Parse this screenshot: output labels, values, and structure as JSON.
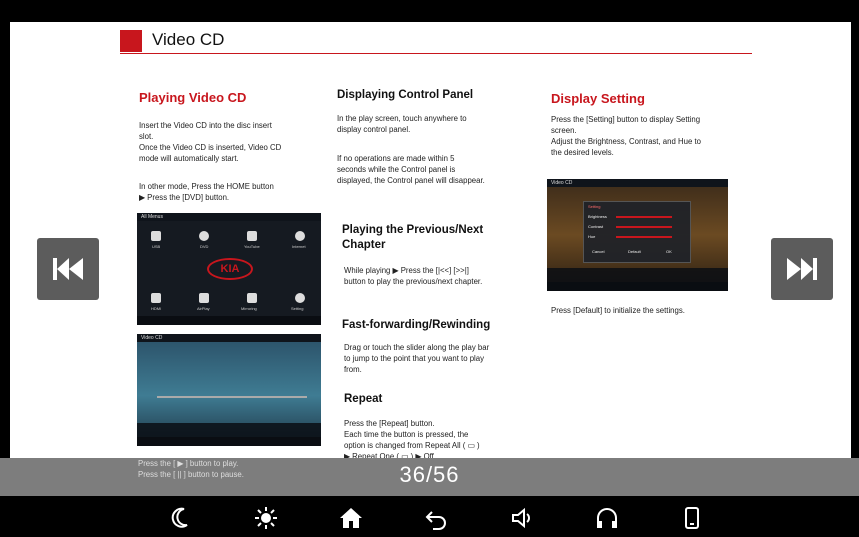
{
  "header": {
    "title": "Video CD"
  },
  "col1": {
    "heading": "Playing Video CD",
    "para1": "Insert the Video CD into the disc insert\nslot.\nOnce the Video CD is inserted, Video CD\nmode will automatically start.",
    "para2": "In other mode, Press the HOME button\n▶ Press the [DVD] button.",
    "menu_screen": {
      "title": "All Menus",
      "items": [
        "USB",
        "DVD",
        "YouTube",
        "Internet",
        "HDMI",
        "AirPlay",
        "Mirroring",
        "Setting"
      ],
      "logo": "KIA"
    },
    "video_screen": {
      "title": "Video CD"
    },
    "caption": "Press the [ ▶ ] button to play.\nPress the [ || ] button to pause."
  },
  "col2": {
    "h1": "Displaying Control Panel",
    "p1": "In the play screen, touch anywhere to\ndisplay control panel.",
    "p2": "If no operations are made within 5\nseconds while the Control panel is\ndisplayed, the Control panel will disappear.",
    "h2": "Playing the Previous/Next\nChapter",
    "p3": "While playing ▶ Press the [|<<] [>>|]\nbutton to play the previous/next chapter.",
    "h3": "Fast-forwarding/Rewinding",
    "p4": "Drag or touch the slider along the play bar\nto jump to the point that you want to play\nfrom.",
    "h4": "Repeat",
    "p5": "Press the [Repeat] button.\nEach time the button is pressed, the\noption is changed from Repeat All ( ▭ )\n▶ Repeat One ( ▭ ) ▶ Off."
  },
  "col3": {
    "heading": "Display Setting",
    "p1": "Press the [Setting] button to display Setting\nscreen.\nAdjust the Brightness, Contrast, and Hue to\nthe desired levels.",
    "settings_screen": {
      "title": "Video CD",
      "panel_title": "Setting",
      "rows": [
        "Brightness",
        "Contrast",
        "Hue"
      ],
      "buttons": [
        "Cancel",
        "Default",
        "OK"
      ]
    },
    "p2": "Press [Default] to initialize the settings."
  },
  "nav": {
    "prev_label": "previous page",
    "next_label": "next page"
  },
  "pager": {
    "current": "36",
    "total": "56",
    "text": "36/56"
  },
  "navbar_icons": [
    "moon-icon",
    "brightness-icon",
    "home-icon",
    "back-icon",
    "volume-icon",
    "headphone-icon",
    "phone-icon"
  ],
  "colors": {
    "accent": "#c8161d",
    "button_bg": "#5c5c5c",
    "footer_bg": "#7d7d7d"
  }
}
